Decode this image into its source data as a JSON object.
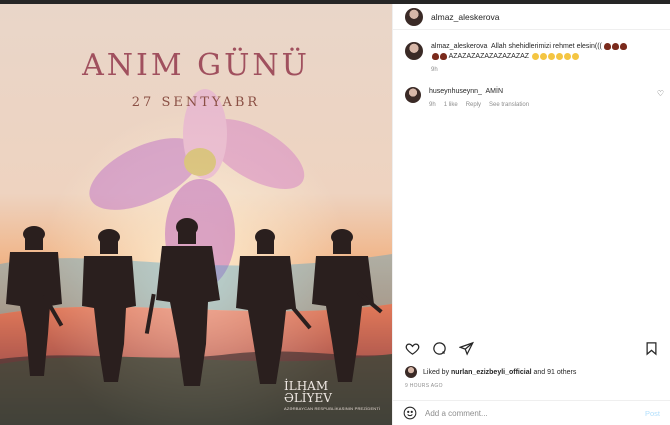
{
  "post": {
    "author": "almaz_aleskerova",
    "image": {
      "title": "ANIM GÜNÜ",
      "date": "27 SENTYABR",
      "signature_name": "İLHAM\nƏLİYEV",
      "signature_sub": "AZƏRBAYCAN RESPUBLİKASININ PREZİDENTİ"
    },
    "comments": [
      {
        "username": "almaz_aleskerova",
        "text": "Allah shehidlerimizi rehmet elesin(((",
        "text2": "AZAZAZAZAZAZAZAZAZ",
        "time": "9h"
      },
      {
        "username": "huseynhuseynn_",
        "text": "AMİN",
        "time": "9h",
        "likes": "1 like",
        "reply": "Reply",
        "translate": "See translation"
      }
    ],
    "likes": {
      "prefix": "Liked by",
      "user": "nurlan_ezizbeyli_official",
      "suffix": "and 91 others"
    },
    "posted_ago": "9 HOURS AGO",
    "add_comment": {
      "placeholder": "Add a comment...",
      "post_label": "Post"
    }
  },
  "icons": {
    "like": "heart-icon",
    "comment": "comment-icon",
    "share": "send-icon",
    "save": "bookmark-icon",
    "emoji": "smile-icon"
  }
}
